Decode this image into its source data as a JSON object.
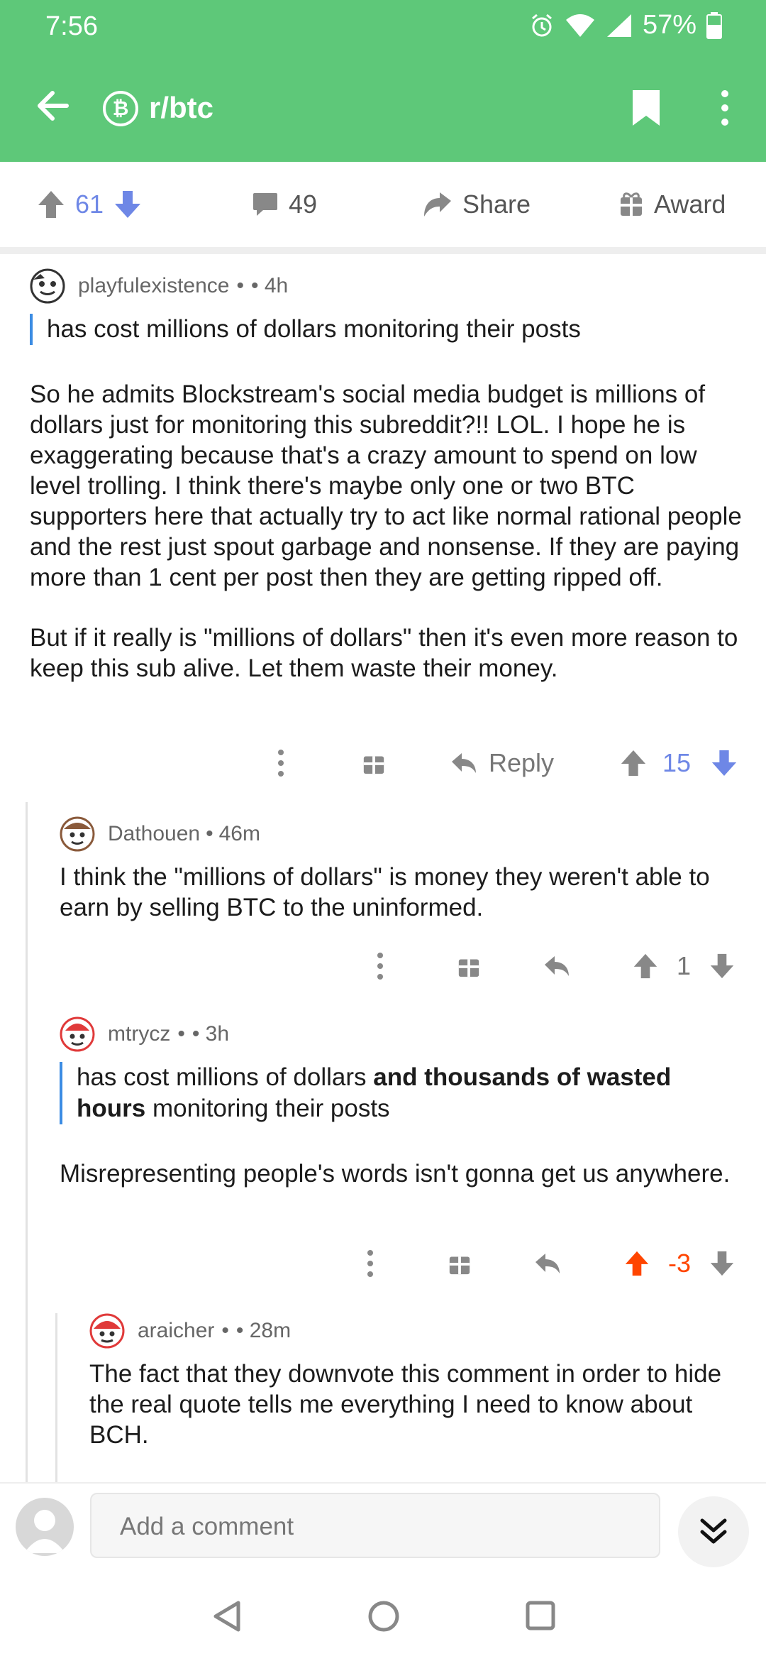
{
  "status": {
    "time": "7:56",
    "battery": "57%"
  },
  "header": {
    "subreddit": "r/btc",
    "sub_icon_glyph": "₿"
  },
  "post_actions": {
    "upvotes": "61",
    "comments": "49",
    "share_label": "Share",
    "award_label": "Award"
  },
  "comments": [
    {
      "author": "playfulexistence",
      "separator": "•",
      "time": "• 4h",
      "quote": "has cost millions of dollars monitoring their posts",
      "paragraphs": [
        "So he admits Blockstream's social media budget is millions of dollars just for monitoring this subreddit?!! LOL. I hope he is exaggerating because that's a crazy amount to spend on low level trolling. I think there's maybe only one or two BTC supporters here that actually try to act like normal rational people and the rest just spout garbage and nonsense. If they are paying more than 1 cent per post then they are getting ripped off.",
        "But if it really is \"millions of dollars\" then it's even more reason to keep this sub alive. Let them waste their money."
      ],
      "reply_label": "Reply",
      "score": "15"
    },
    {
      "author": "Dathouen",
      "separator": "•",
      "time": "46m",
      "paragraphs": [
        "I think the \"millions of dollars\" is money they weren't able to earn by selling BTC to the uninformed."
      ],
      "score": "1"
    },
    {
      "author": "mtrycz",
      "separator": "•",
      "time": "• 3h",
      "quote_parts": [
        "has cost millions of dollars ",
        "and thousands of wasted hours",
        " monitoring their posts"
      ],
      "paragraphs": [
        "Misrepresenting people's words isn't gonna get us anywhere."
      ],
      "score": "-3"
    },
    {
      "author": "araicher",
      "separator": "•",
      "time": "• 28m",
      "paragraphs": [
        "The fact that they downvote this comment in order to hide the real quote tells me everything I need to know about BCH."
      ]
    }
  ],
  "composer": {
    "placeholder": "Add a comment"
  },
  "colors": {
    "header": "#5ec879",
    "upvote_blue": "#6e87e6",
    "downvote_active": "#ff4500",
    "quote_bar": "#3b8ce3"
  }
}
